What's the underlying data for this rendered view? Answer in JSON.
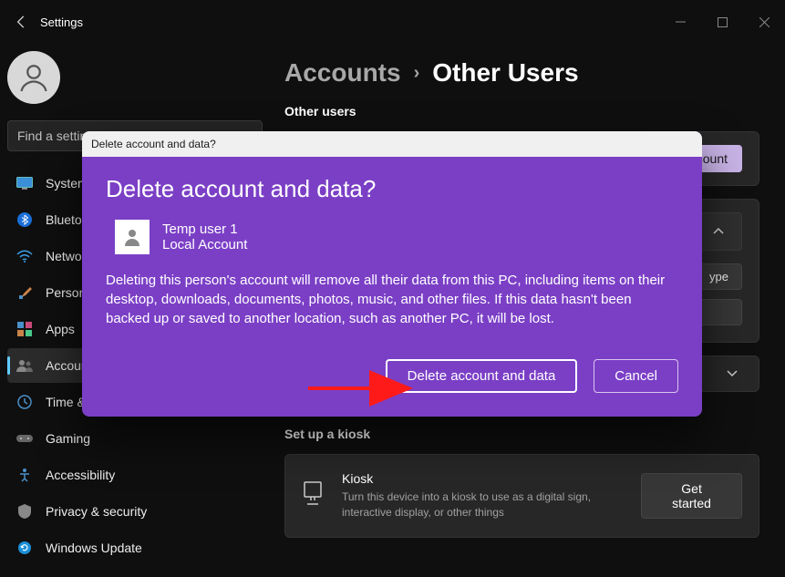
{
  "app": {
    "title": "Settings"
  },
  "search": {
    "placeholder": "Find a setting"
  },
  "nav": [
    {
      "label": "System",
      "icon": "🖥️"
    },
    {
      "label": "Bluetooth & devices",
      "icon": "bt"
    },
    {
      "label": "Network & internet",
      "icon": "wifi"
    },
    {
      "label": "Personalization",
      "icon": "🖌️"
    },
    {
      "label": "Apps",
      "icon": "apps"
    },
    {
      "label": "Accounts",
      "icon": "acct"
    },
    {
      "label": "Time & language",
      "icon": "🕒"
    },
    {
      "label": "Gaming",
      "icon": "🎮"
    },
    {
      "label": "Accessibility",
      "icon": "acc"
    },
    {
      "label": "Privacy & security",
      "icon": "🛡️"
    },
    {
      "label": "Windows Update",
      "icon": "wu"
    }
  ],
  "breadcrumb": {
    "parent": "Accounts",
    "current": "Other Users"
  },
  "sections": {
    "other_users": "Other users",
    "setup_kiosk": "Set up a kiosk"
  },
  "add_account_btn": "Add account",
  "change_type_btn": "Change account type",
  "kiosk": {
    "title": "Kiosk",
    "desc": "Turn this device into a kiosk to use as a digital sign, interactive display, or other things",
    "btn": "Get started"
  },
  "dialog": {
    "titlebar": "Delete account and data?",
    "heading": "Delete account and data?",
    "user_name": "Temp user 1",
    "user_type": "Local Account",
    "message": "Deleting this person's account will remove all their data from this PC, including items on their desktop, downloads, documents, photos, music, and other files. If this data hasn't been backed up or saved to another location, such as another PC, it will be lost.",
    "primary_btn": "Delete account and data",
    "cancel_btn": "Cancel"
  }
}
